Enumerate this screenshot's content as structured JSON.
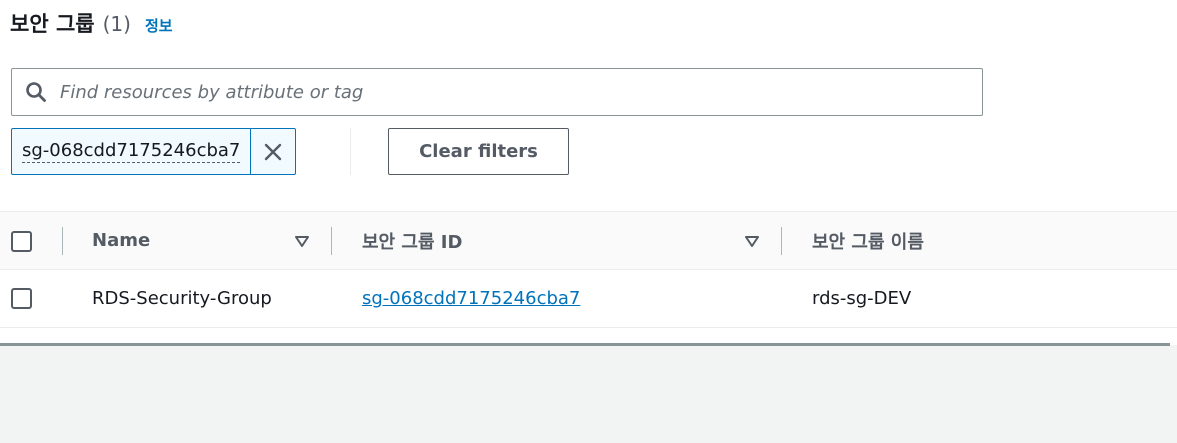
{
  "header": {
    "title": "보안 그룹",
    "count": "(1)",
    "info_link": "정보"
  },
  "search": {
    "placeholder": "Find resources by attribute or tag",
    "icon": "search-icon"
  },
  "filter_token": {
    "label": "sg-068cdd7175246cba7",
    "remove_icon": "close-icon"
  },
  "clear_filters_label": "Clear filters",
  "table": {
    "columns": [
      {
        "label": "Name",
        "sortable": true
      },
      {
        "label": "보안 그룹 ID",
        "sortable": true
      },
      {
        "label": "보안 그룹 이름",
        "sortable": false
      }
    ],
    "rows": [
      {
        "name": "RDS-Security-Group",
        "group_id": "sg-068cdd7175246cba7",
        "group_name": "rds-sg-DEV",
        "selected": false
      }
    ]
  },
  "colors": {
    "link": "#0073bb",
    "text": "#16191f",
    "muted": "#545b64",
    "border": "#eaeded"
  }
}
